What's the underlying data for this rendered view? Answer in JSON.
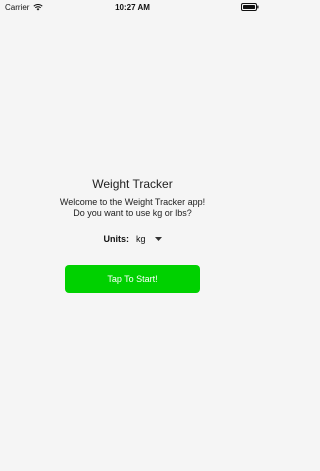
{
  "status_bar": {
    "carrier": "Carrier",
    "time": "10:27 AM"
  },
  "main": {
    "title": "Weight Tracker",
    "message_line1": "Welcome to the Weight Tracker app!",
    "message_line2": "Do you want to use kg or lbs?",
    "units_label": "Units:",
    "units_value": "kg",
    "start_button_label": "Tap To Start!"
  },
  "icons": {
    "wifi": "wifi-icon",
    "battery": "battery-icon",
    "dropdown": "chevron-down-icon"
  },
  "colors": {
    "background": "#f5f5f5",
    "start_button": "#00d100",
    "start_button_text": "#ffffff"
  }
}
